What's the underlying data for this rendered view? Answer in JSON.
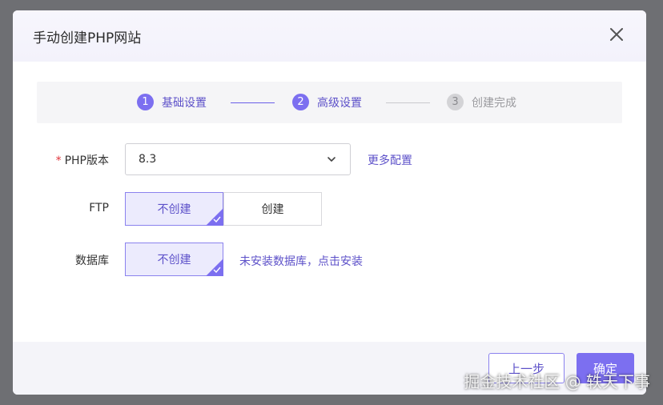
{
  "dialog": {
    "title": "手动创建PHP网站"
  },
  "steps": [
    {
      "num": "1",
      "label": "基础设置",
      "state": "active"
    },
    {
      "num": "2",
      "label": "高级设置",
      "state": "active"
    },
    {
      "num": "3",
      "label": "创建完成",
      "state": "pending"
    }
  ],
  "form": {
    "php_version": {
      "required_mark": "*",
      "label": "PHP版本",
      "value": "8.3",
      "more_link": "更多配置"
    },
    "ftp": {
      "label": "FTP",
      "options": [
        "不创建",
        "创建"
      ],
      "selected": "不创建"
    },
    "database": {
      "label": "数据库",
      "options": [
        "不创建"
      ],
      "selected": "不创建",
      "hint_link": "未安装数据库，点击安装"
    }
  },
  "footer": {
    "prev_label": "上一步",
    "confirm_label": "确定"
  },
  "watermark": "掘金技术社区 @ 轶天下事",
  "colors": {
    "accent": "#7c6ff0",
    "accent_text": "#5d51c9",
    "required": "#e0353b"
  },
  "icons": [
    "close-icon",
    "chevron-down-icon",
    "check-icon"
  ]
}
